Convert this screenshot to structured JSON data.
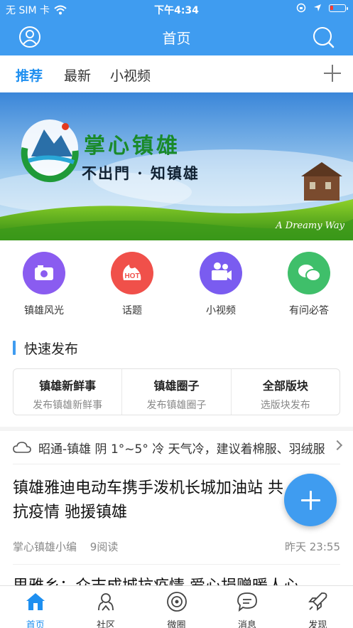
{
  "status": {
    "carrier": "无 SIM 卡",
    "time": "下午4:34"
  },
  "nav": {
    "title": "首页"
  },
  "tabs": [
    {
      "label": "推荐",
      "active": true
    },
    {
      "label": "最新",
      "active": false
    },
    {
      "label": "小视频",
      "active": false
    }
  ],
  "banner": {
    "title": "掌心镇雄",
    "subtitle": "不出門 · 知镇雄",
    "signature": "A Dreamy Way"
  },
  "categories": [
    {
      "label": "镇雄风光",
      "icon": "camera-icon",
      "color": "#8a5cf0"
    },
    {
      "label": "话题",
      "icon": "hot-icon",
      "color": "#f0504a"
    },
    {
      "label": "小视频",
      "icon": "video-camera-icon",
      "color": "#7a5cf0"
    },
    {
      "label": "有问必答",
      "icon": "chat-bubbles-icon",
      "color": "#3fbf6a"
    }
  ],
  "quick_publish": {
    "title": "快速发布",
    "items": [
      {
        "heading": "镇雄新鲜事",
        "sub": "发布镇雄新鲜事"
      },
      {
        "heading": "镇雄圈子",
        "sub": "发布镇雄圈子"
      },
      {
        "heading": "全部版块",
        "sub": "选版块发布"
      }
    ]
  },
  "weather": {
    "text": "昭通-镇雄 阴 1°~5° 冷 天气冷，建议着棉服、羽绒服"
  },
  "articles": [
    {
      "title": "镇雄雅迪电动车携手泼机长城加油站 共抗疫情 驰援镇雄",
      "author": "掌心镇雄小编",
      "reads": "9阅读",
      "time": "昨天 23:55"
    },
    {
      "title": "思雅乡：众志成城抗疫情 爱心捐赠暖人心"
    }
  ],
  "tabbar": [
    {
      "label": "首页",
      "icon": "home-icon",
      "active": true
    },
    {
      "label": "社区",
      "icon": "community-icon",
      "active": false
    },
    {
      "label": "微圈",
      "icon": "circle-icon",
      "active": false
    },
    {
      "label": "消息",
      "icon": "message-icon",
      "active": false
    },
    {
      "label": "发现",
      "icon": "rocket-icon",
      "active": false
    }
  ],
  "colors": {
    "primary": "#3f9cf0",
    "active_tab": "#1e8ff0"
  }
}
